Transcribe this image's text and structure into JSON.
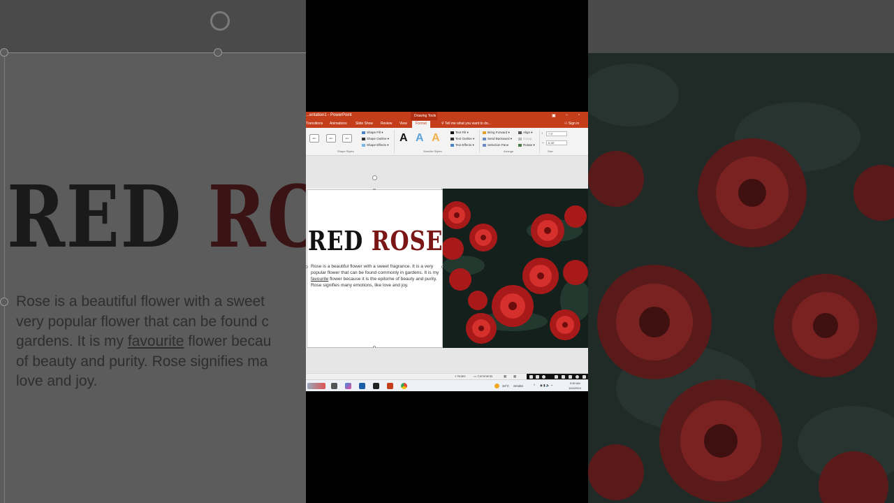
{
  "window": {
    "title": "...entation1 - PowerPoint",
    "context_tab_group": "Drawing Tools",
    "accent": "#c43e1c"
  },
  "tabs": [
    {
      "label": "Transitions"
    },
    {
      "label": "Animations"
    },
    {
      "label": "Slide Show"
    },
    {
      "label": "Review"
    },
    {
      "label": "View"
    },
    {
      "label": "Format",
      "active": true
    }
  ],
  "tell_me": "Tell me what you want to do...",
  "sign_in": "Sign in",
  "ribbon": {
    "shape_styles": {
      "presets": [
        "Abc",
        "Abc",
        "Abc"
      ],
      "fill": "Shape Fill",
      "outline": "Shape Outline",
      "effects": "Shape Effects",
      "label": "Shape Styles"
    },
    "wordart_styles": {
      "presets": [
        "A",
        "A",
        "A"
      ],
      "text_fill": "Text Fill",
      "text_outline": "Text Outline",
      "text_effects": "Text Effects",
      "label": "WordArt Styles"
    },
    "arrange": {
      "bring_forward": "Bring Forward",
      "send_backward": "Send Backward",
      "selection_pane": "Selection Pane",
      "align": "Align",
      "group": "Group",
      "rotate": "Rotate",
      "label": "Arrange"
    },
    "size": {
      "height": "7.5\"",
      "width": "6.38\"",
      "label": "Size"
    }
  },
  "slide": {
    "title_part1": "RED",
    "title_part2": "ROSE",
    "body_before": "Rose ",
    "body_text_1": "is a beautiful flower with a sweet fragrance. It is a very popular flower that can be found commonly in gardens. It is my ",
    "body_underlined": "favourite",
    "body_text_2": " flower because it is the epitome of beauty and purity. Rose signifies many emotions, like love and joy."
  },
  "status_bar": {
    "notes": "Notes",
    "comments": "Comments"
  },
  "taskbar": {
    "weather": "34°C",
    "weather_desc": "Smoke",
    "time": "5:50 AM",
    "date": "10/4/2024"
  },
  "background": {
    "title_part1": "RED",
    "title_part2": "RO",
    "body_line1": "Rose is a beautiful flower with a sweet",
    "body_line2": "very popular flower that can be found c",
    "body_line3_a": "gardens. It is my ",
    "body_line3_u": "favourite",
    "body_line3_b": " flower becau",
    "body_line4": "of beauty and purity. Rose signifies ma",
    "body_line5": "love and joy."
  }
}
